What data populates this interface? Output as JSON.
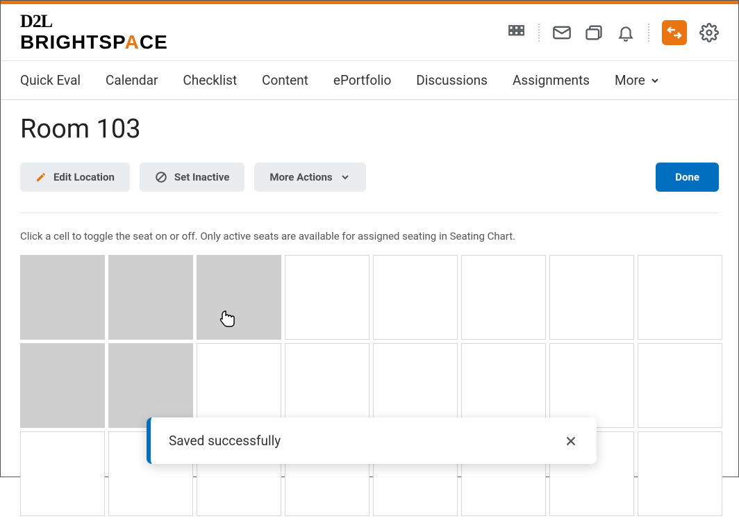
{
  "logo": {
    "d2l": "D2L",
    "brightspace_pre": "BRIGHTSP",
    "brightspace_accent": "A",
    "brightspace_post": "CE"
  },
  "nav": {
    "quick_eval": "Quick Eval",
    "calendar": "Calendar",
    "checklist": "Checklist",
    "content": "Content",
    "eportfolio": "ePortfolio",
    "discussions": "Discussions",
    "assignments": "Assignments",
    "more": "More"
  },
  "page": {
    "title": "Room 103",
    "instruction": "Click a cell to toggle the seat on or off. Only active seats are available for assigned seating in Seating Chart."
  },
  "toolbar": {
    "edit_location": "Edit Location",
    "set_inactive": "Set Inactive",
    "more_actions": "More Actions",
    "done": "Done"
  },
  "seats": {
    "cols": 8,
    "rows_visible": 3,
    "active_cells": [
      "0-0",
      "0-1",
      "0-2",
      "1-0",
      "1-1"
    ]
  },
  "toast": {
    "message": "Saved successfully"
  }
}
